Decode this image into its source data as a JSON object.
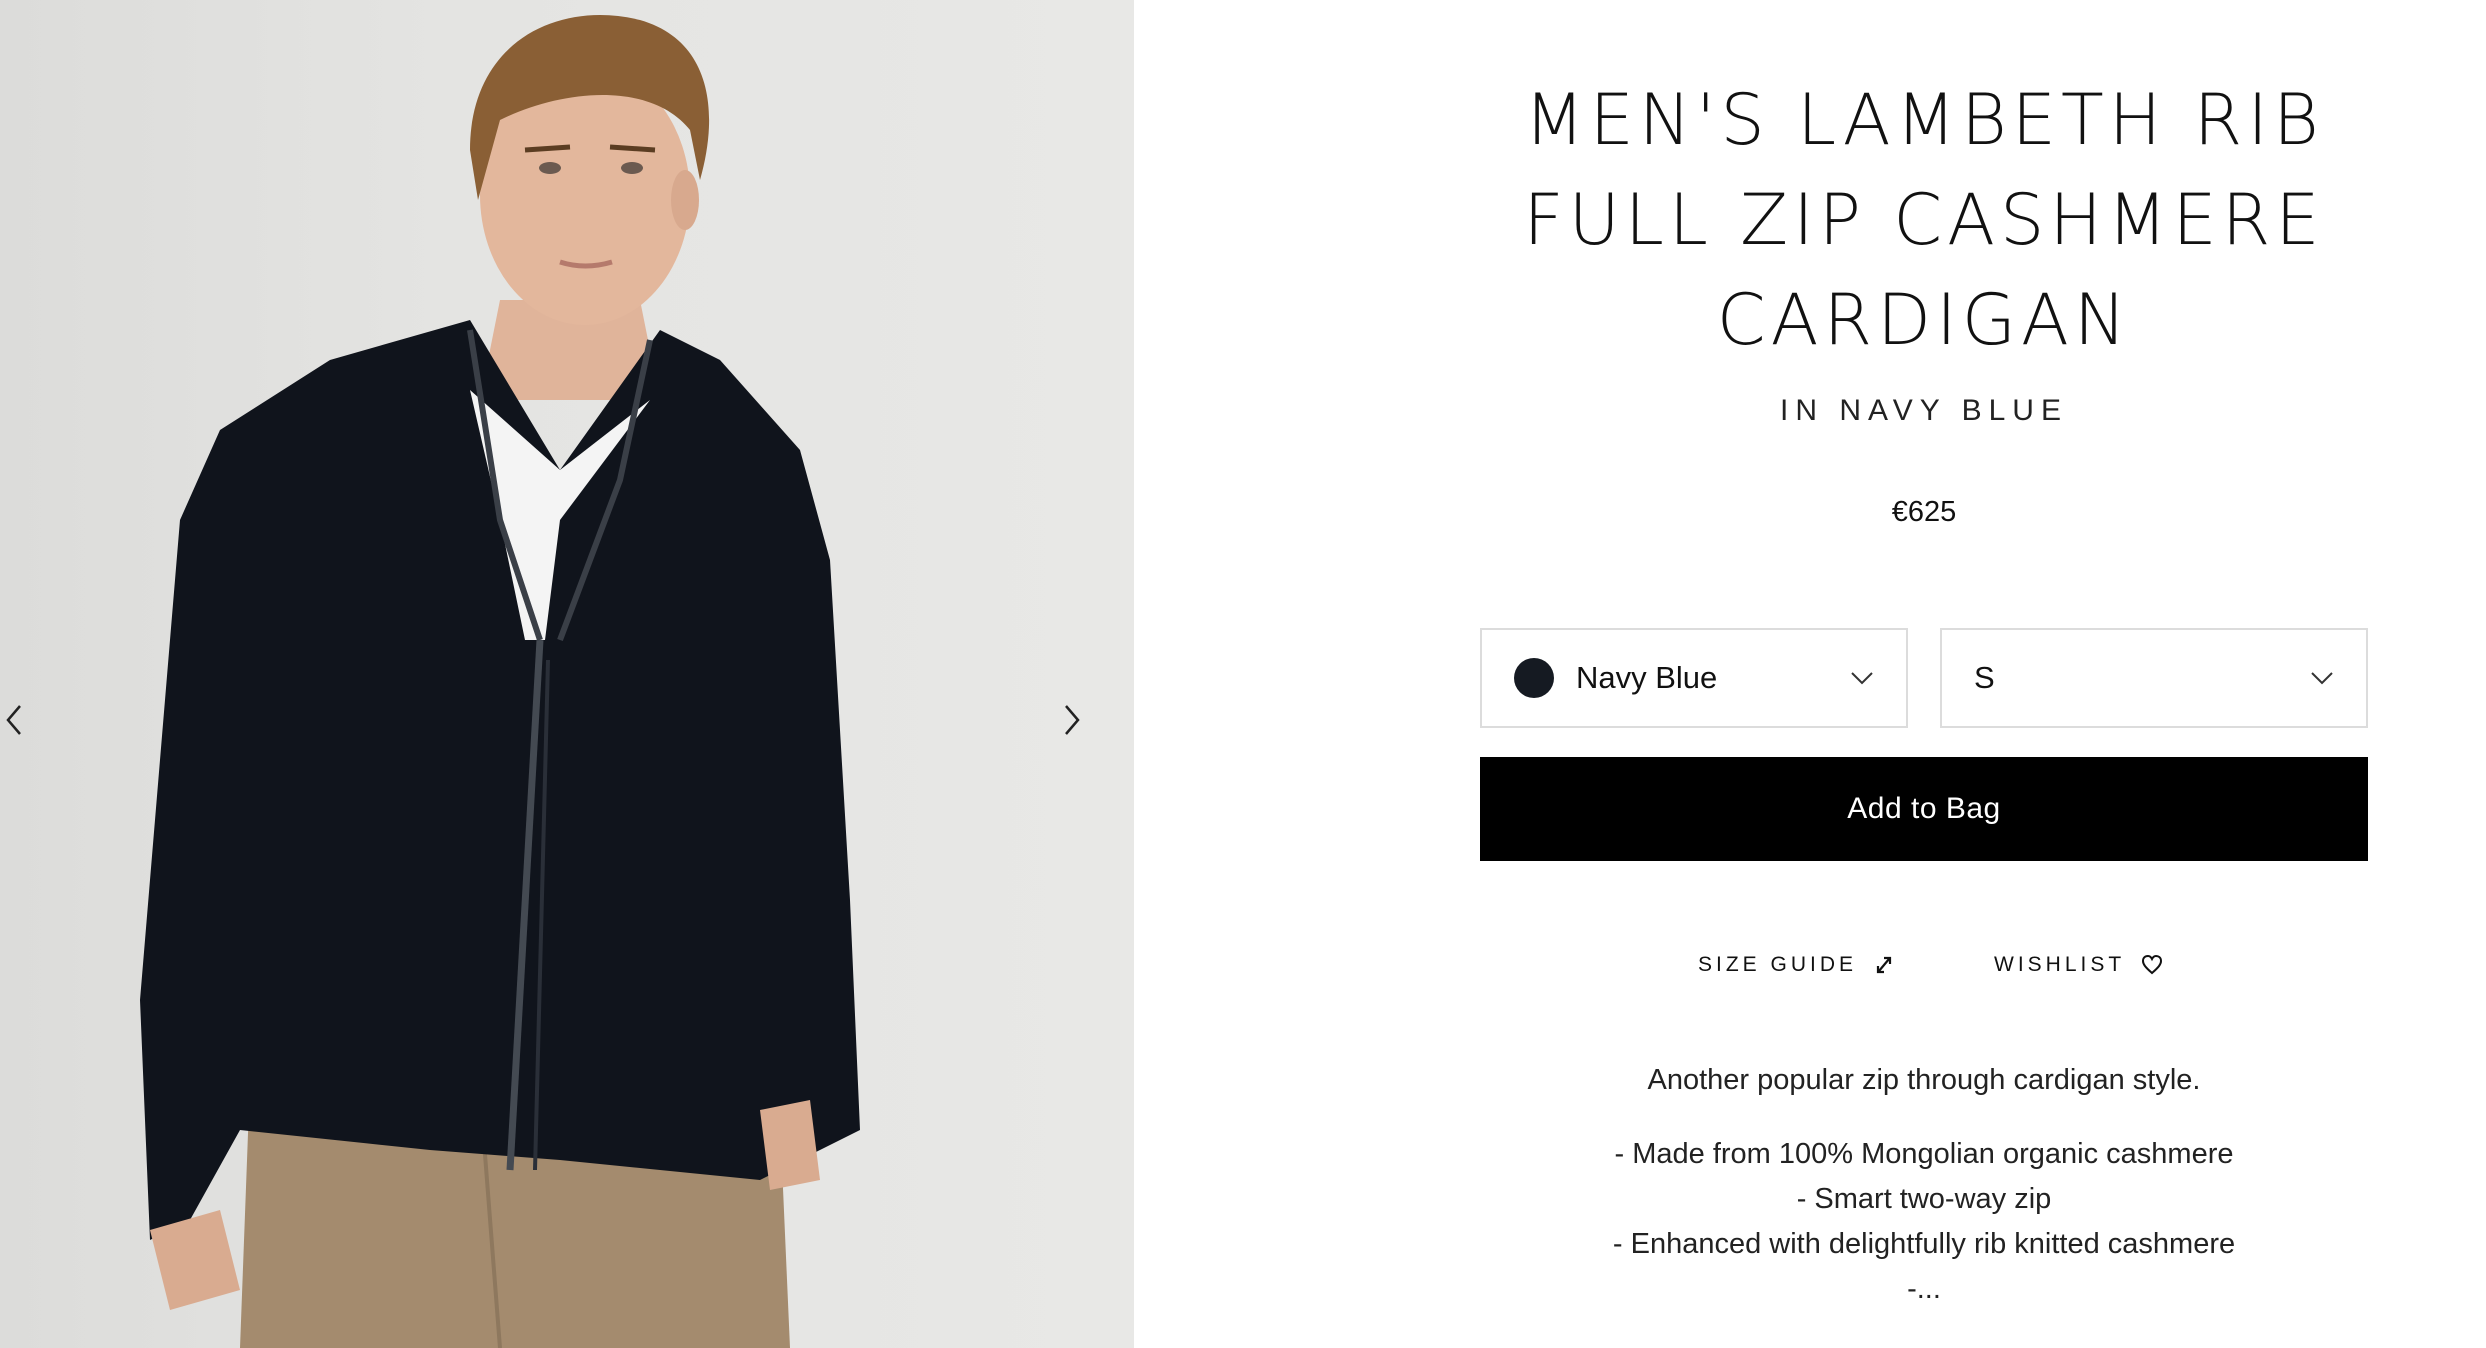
{
  "gallery": {
    "prev_icon": "chevron-left-icon",
    "next_icon": "chevron-right-icon"
  },
  "product": {
    "title": "MEN'S LAMBETH RIB FULL ZIP CASHMERE CARDIGAN",
    "subtitle": "IN NAVY BLUE",
    "price": "€625",
    "color_select": {
      "value": "Navy Blue",
      "swatch_color": "#151a22",
      "icon": "chevron-down-icon"
    },
    "size_select": {
      "value": "S",
      "icon": "chevron-down-icon"
    },
    "add_to_bag": "Add to Bag",
    "size_guide": "SIZE GUIDE",
    "size_guide_icon": "expand-icon",
    "wishlist": "WISHLIST",
    "wishlist_icon": "heart-icon",
    "description": {
      "lead": "Another popular zip through cardigan style.",
      "bullets": [
        "- Made from 100% Mongolian organic cashmere",
        "- Smart two-way zip",
        "- Enhanced with delightfully rib knitted cashmere",
        "-..."
      ]
    }
  },
  "colors": {
    "button_bg": "#000000",
    "button_text": "#ffffff",
    "border": "#dcdcdc"
  }
}
